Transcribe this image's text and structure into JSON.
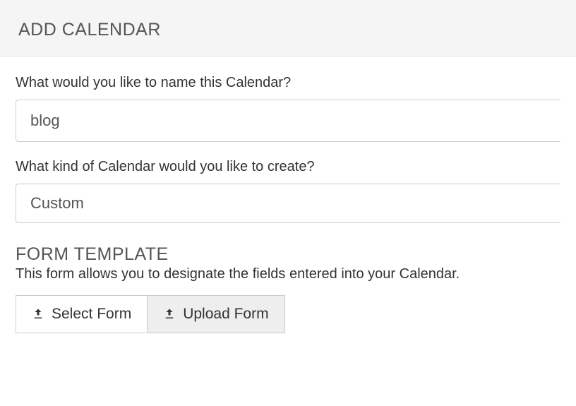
{
  "header": {
    "title": "ADD CALENDAR"
  },
  "form": {
    "name_label": "What would you like to name this Calendar?",
    "name_value": "blog",
    "kind_label": "What kind of Calendar would you like to create?",
    "kind_value": "Custom"
  },
  "template_section": {
    "title": "FORM TEMPLATE",
    "description": "This form allows you to designate the fields entered into your Calendar.",
    "select_button": "Select Form",
    "upload_button": "Upload Form"
  }
}
